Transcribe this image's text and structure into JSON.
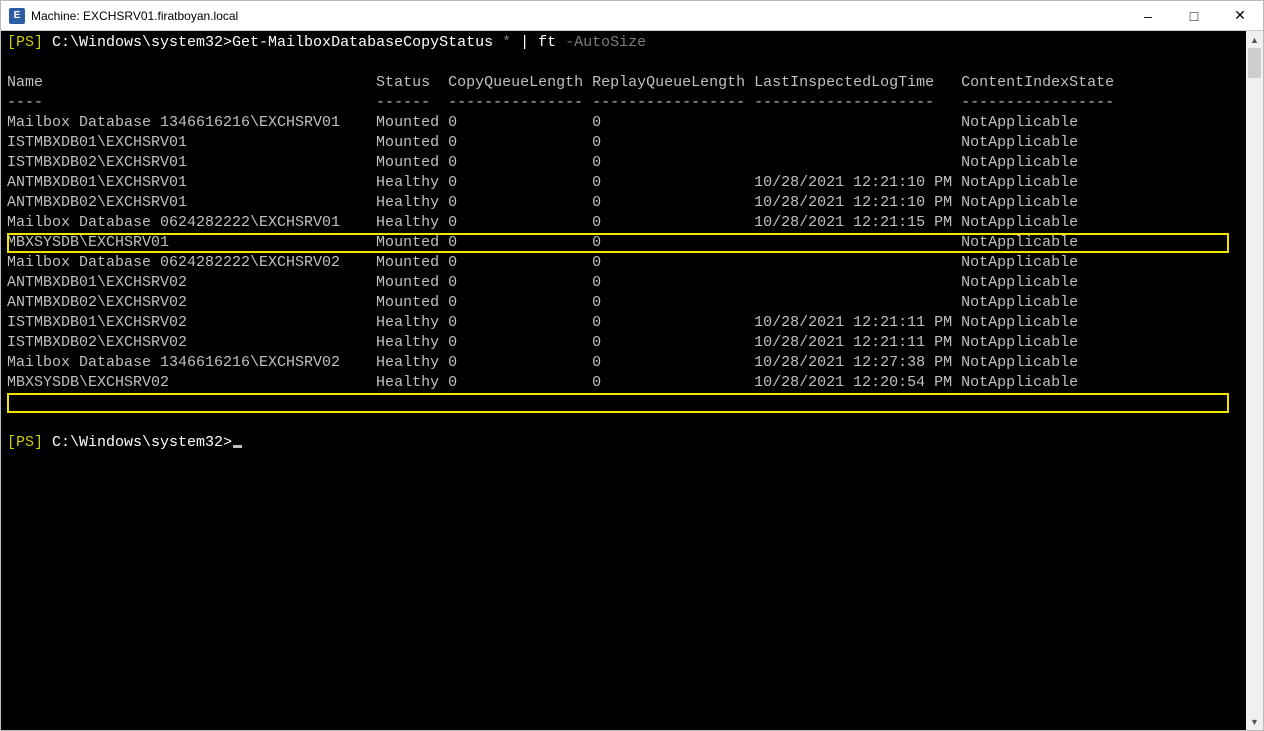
{
  "window": {
    "icon_text": "E",
    "title": "Machine: EXCHSRV01.firatboyan.local"
  },
  "prompt": {
    "ps": "[PS]",
    "path": " C:\\Windows\\system32>",
    "cmd": "Get-MailboxDatabaseCopyStatus",
    "star": " *",
    "pipe": " |",
    "ft": " ft",
    "autosize": " -AutoSize"
  },
  "headers": {
    "name": "Name",
    "status": "Status",
    "copyq": "CopyQueueLength",
    "replayq": "ReplayQueueLength",
    "lastlog": "LastInspectedLogTime",
    "cis": "ContentIndexState"
  },
  "dashes": {
    "name": "----",
    "status": "------",
    "copyq": "---------------",
    "replayq": "-----------------",
    "lastlog": "--------------------",
    "cis": "-----------------"
  },
  "rows": [
    {
      "name": "Mailbox Database 1346616216\\EXCHSRV01",
      "status": "Mounted",
      "cq": "0",
      "rq": "0",
      "ll": "",
      "cis": "NotApplicable"
    },
    {
      "name": "ISTMBXDB01\\EXCHSRV01",
      "status": "Mounted",
      "cq": "0",
      "rq": "0",
      "ll": "",
      "cis": "NotApplicable"
    },
    {
      "name": "ISTMBXDB02\\EXCHSRV01",
      "status": "Mounted",
      "cq": "0",
      "rq": "0",
      "ll": "",
      "cis": "NotApplicable"
    },
    {
      "name": "ANTMBXDB01\\EXCHSRV01",
      "status": "Healthy",
      "cq": "0",
      "rq": "0",
      "ll": "10/28/2021 12:21:10 PM",
      "cis": "NotApplicable"
    },
    {
      "name": "ANTMBXDB02\\EXCHSRV01",
      "status": "Healthy",
      "cq": "0",
      "rq": "0",
      "ll": "10/28/2021 12:21:10 PM",
      "cis": "NotApplicable"
    },
    {
      "name": "Mailbox Database 0624282222\\EXCHSRV01",
      "status": "Healthy",
      "cq": "0",
      "rq": "0",
      "ll": "10/28/2021 12:21:15 PM",
      "cis": "NotApplicable"
    },
    {
      "name": "MBXSYSDB\\EXCHSRV01",
      "status": "Mounted",
      "cq": "0",
      "rq": "0",
      "ll": "",
      "cis": "NotApplicable"
    },
    {
      "name": "Mailbox Database 0624282222\\EXCHSRV02",
      "status": "Mounted",
      "cq": "0",
      "rq": "0",
      "ll": "",
      "cis": "NotApplicable"
    },
    {
      "name": "ANTMBXDB01\\EXCHSRV02",
      "status": "Mounted",
      "cq": "0",
      "rq": "0",
      "ll": "",
      "cis": "NotApplicable"
    },
    {
      "name": "ANTMBXDB02\\EXCHSRV02",
      "status": "Mounted",
      "cq": "0",
      "rq": "0",
      "ll": "",
      "cis": "NotApplicable"
    },
    {
      "name": "ISTMBXDB01\\EXCHSRV02",
      "status": "Healthy",
      "cq": "0",
      "rq": "0",
      "ll": "10/28/2021 12:21:11 PM",
      "cis": "NotApplicable"
    },
    {
      "name": "ISTMBXDB02\\EXCHSRV02",
      "status": "Healthy",
      "cq": "0",
      "rq": "0",
      "ll": "10/28/2021 12:21:11 PM",
      "cis": "NotApplicable"
    },
    {
      "name": "Mailbox Database 1346616216\\EXCHSRV02",
      "status": "Healthy",
      "cq": "0",
      "rq": "0",
      "ll": "10/28/2021 12:27:38 PM",
      "cis": "NotApplicable"
    },
    {
      "name": "MBXSYSDB\\EXCHSRV02",
      "status": "Healthy",
      "cq": "0",
      "rq": "0",
      "ll": "10/28/2021 12:20:54 PM",
      "cis": "NotApplicable"
    }
  ],
  "prompt2": {
    "ps": "[PS]",
    "path": " C:\\Windows\\system32>"
  },
  "cols": {
    "name": 41,
    "status": 8,
    "cq": 16,
    "rq": 18,
    "ll": 23
  }
}
